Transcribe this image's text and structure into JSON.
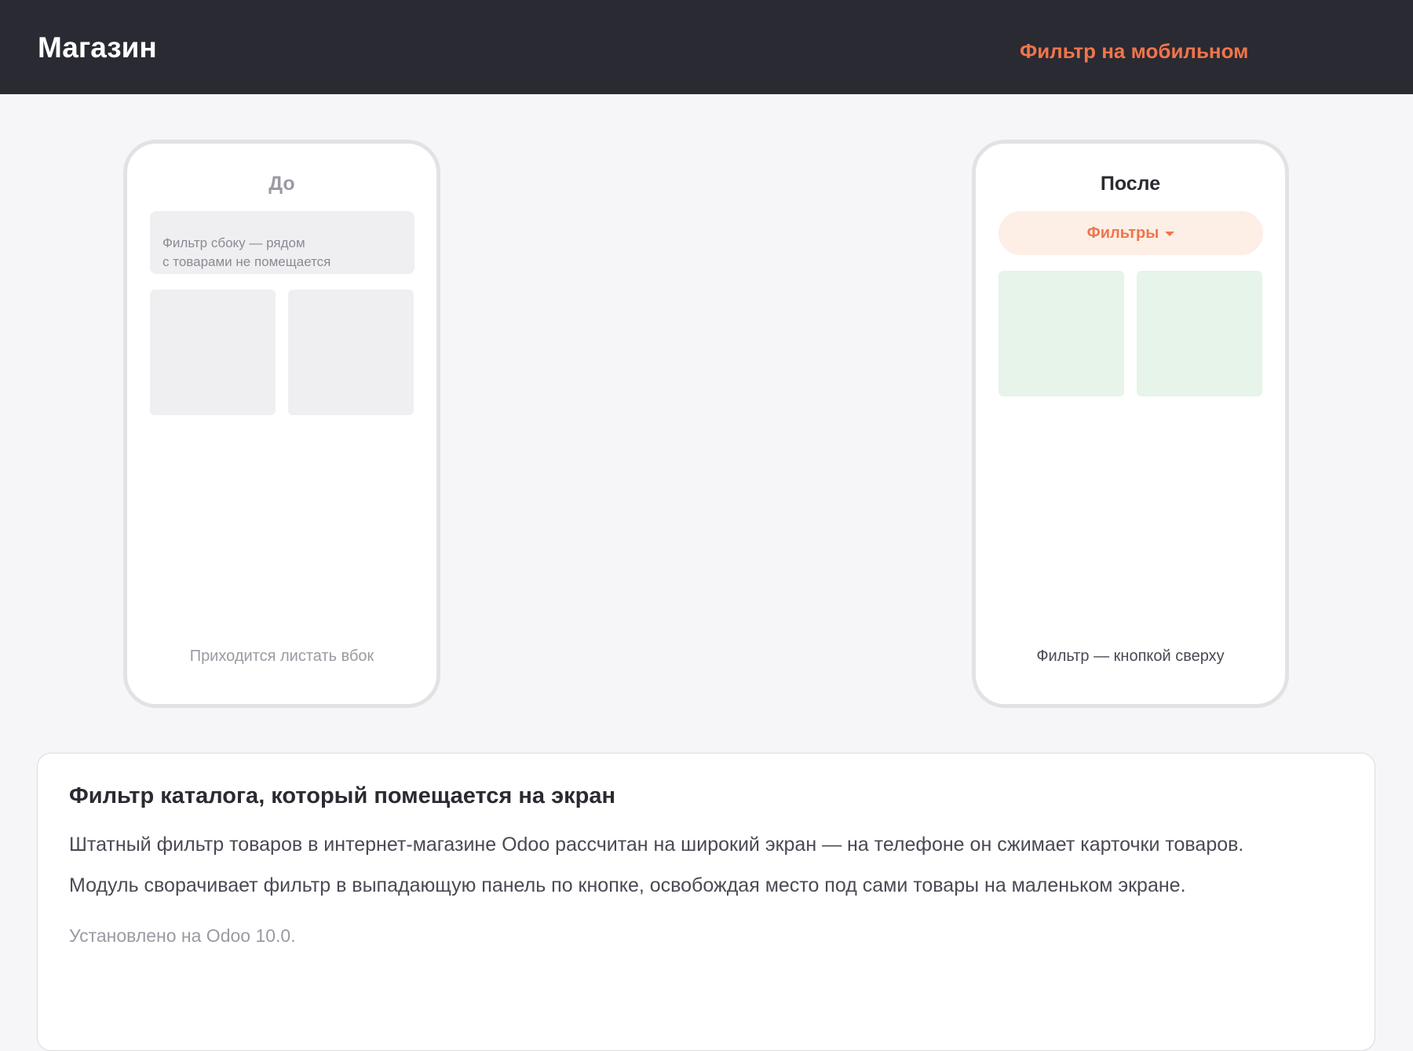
{
  "header": {
    "title": "Магазин",
    "promo": "Фильтр на мобильном"
  },
  "before": {
    "heading": "До",
    "filter_line1": "Фильтр сбоку — рядом",
    "filter_line2": "с товарами не помещается",
    "caption": "Приходится листать вбок"
  },
  "after": {
    "heading": "После",
    "filter_button": "Фильтры",
    "caption": "Фильтр — кнопкой сверху"
  },
  "card": {
    "title": "Фильтр каталога, который помещается на экран",
    "paragraph1": "Штатный фильтр товаров в интернет-магазине Odoo рассчитан на широкий экран — на телефоне он сжимает карточки товаров.",
    "paragraph2": "Модуль сворачивает фильтр в выпадающую панель по кнопке, освобождая место под сами товары на маленьком экране.",
    "note": "Установлено на Odoo 10.0."
  },
  "colors": {
    "header_bg": "#2a2a32",
    "accent": "#f0754c",
    "accent_soft": "#fdeee6",
    "product_tile_after": "#e6f4ea",
    "product_tile_before": "#efeff2"
  },
  "icons": {
    "filter_caret": "caret-down-icon"
  }
}
